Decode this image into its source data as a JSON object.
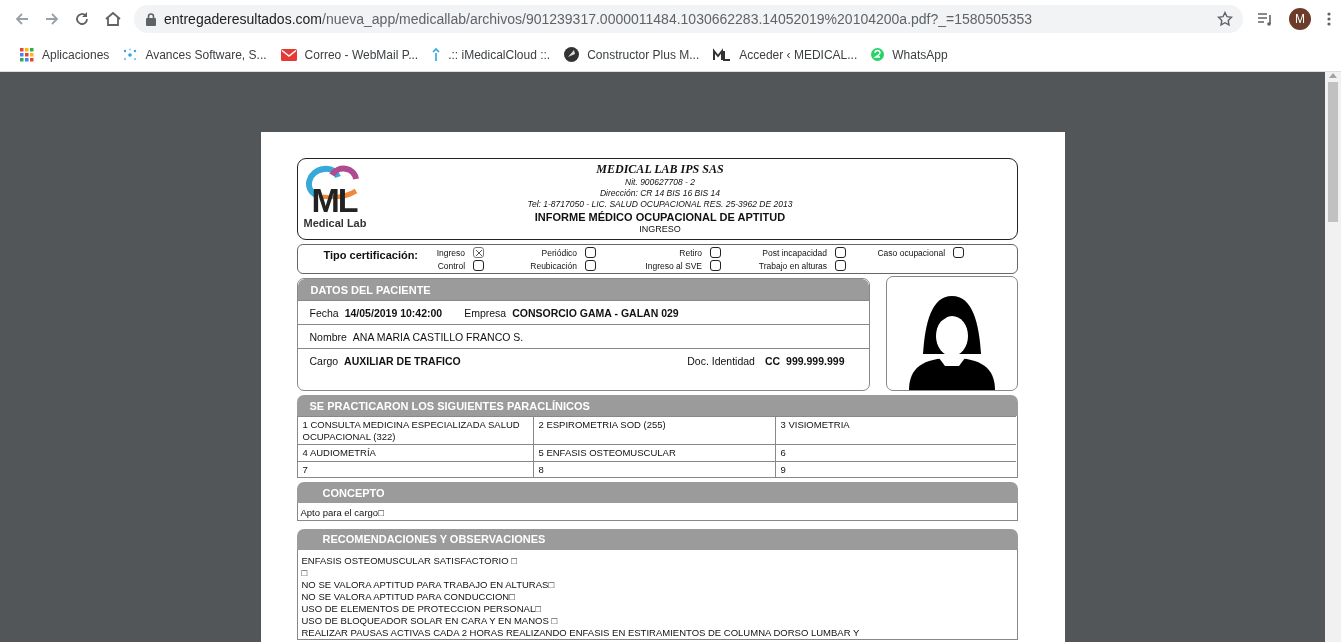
{
  "browser": {
    "url_host": "entregaderesultados.com",
    "url_path": "/nueva_app/medicallab/archivos/901239317.0000011484.1030662283.14052019%20104200a.pdf?_=1580505353",
    "profile_initial": "M"
  },
  "bookmarks": [
    {
      "label": "Aplicaciones",
      "kind": "apps"
    },
    {
      "label": "Avances Software, S...",
      "kind": "dots"
    },
    {
      "label": "Correo - WebMail P...",
      "kind": "mail"
    },
    {
      "label": ".:: iMedicalCloud ::.",
      "kind": "pin"
    },
    {
      "label": "Constructor Plus M...",
      "kind": "disc"
    },
    {
      "label": "Acceder ‹ MEDICAL...",
      "kind": "ml"
    },
    {
      "label": "WhatsApp",
      "kind": "chat"
    }
  ],
  "document": {
    "header": {
      "logo_text": "ML",
      "logo_caption": "Medical Lab",
      "company": "MEDICAL LAB IPS SAS",
      "nit": "Nit. 900627708 - 2",
      "address": "Dirección: CR 14 BIS 16 BIS 14",
      "phone": "Tel: 1-8717050 - LIC. SALUD OCUPACIONAL RES. 25-3962 DE 2013",
      "report_title": "INFORME MÉDICO OCUPACIONAL DE APTITUD",
      "report_type": "INGRESO"
    },
    "certification": {
      "label": "Tipo certificación:",
      "options": [
        {
          "label": "Ingreso",
          "checked": true
        },
        {
          "label": "Periódico",
          "checked": false
        },
        {
          "label": "Retiro",
          "checked": false
        },
        {
          "label": "Post incapacidad",
          "checked": false
        },
        {
          "label": "Caso ocupacional",
          "checked": false
        },
        {
          "label": "Control",
          "checked": false
        },
        {
          "label": "Reubicación",
          "checked": false
        },
        {
          "label": "Ingreso al SVE",
          "checked": false
        },
        {
          "label": "Trabajo en alturas",
          "checked": false
        }
      ]
    },
    "patient": {
      "title": "DATOS DEL PACIENTE",
      "date_label": "Fecha",
      "date": "14/05/2019 10:42:00",
      "company_label": "Empresa",
      "company": "CONSORCIO GAMA - GALAN 029",
      "name_label": "Nombre",
      "name": "ANA MARIA CASTILLO FRANCO S.",
      "position_label": "Cargo",
      "position": "AUXILIAR DE TRAFICO",
      "id_label": "Doc. Identidad",
      "id_type": "CC",
      "id_number": "999.999.999"
    },
    "tests": {
      "title": "SE PRACTICARON LOS SIGUIENTES PARACLÍNICOS",
      "cells": [
        "1   CONSULTA MEDICINA ESPECIALIZADA SALUD OCUPACIONAL  (322)",
        "2   ESPIROMETRIA SOD    (255)",
        "3   VISIOMETRIA",
        "4   AUDIOMETRÍA",
        "5   ENFASIS OSTEOMUSCULAR",
        "6",
        "7",
        "8",
        "9"
      ]
    },
    "concept": {
      "title": "CONCEPTO",
      "text": "Apto para el cargo□"
    },
    "recommendations": {
      "title": "RECOMENDACIONES Y OBSERVACIONES",
      "lines": [
        "ENFASIS OSTEOMUSCULAR SATISFACTORIO □",
        "□",
        "NO SE VALORA APTITUD PARA TRABAJO EN ALTURAS□",
        "NO SE VALORA APTITUD PARA CONDUCCION□",
        "USO DE ELEMENTOS DE PROTECCION PERSONAL□",
        "USO DE BLOQUEADOR SOLAR EN CARA Y EN MANOS  □",
        "REALIZAR PAUSAS ACTIVAS CADA 2 HORAS REALIZANDO ENFASIS EN ESTIRAMIENTOS DE COLUMNA DORSO LUMBAR Y"
      ]
    }
  }
}
